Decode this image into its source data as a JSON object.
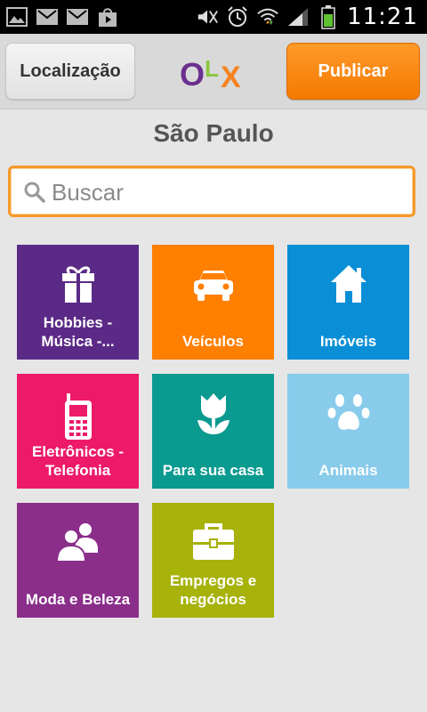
{
  "status_bar": {
    "time": "11:21",
    "left_icons": [
      "image-icon",
      "mail-icon",
      "mail-icon",
      "store-icon"
    ],
    "right_icons": [
      "mute-icon",
      "alarm-icon",
      "wifi-icon",
      "signal-icon",
      "battery-icon"
    ]
  },
  "header": {
    "location_label": "Localização",
    "publish_label": "Publicar",
    "logo_letters": [
      "O",
      "L",
      "X"
    ],
    "logo_colors": [
      "#6a2f8e",
      "#8dc63f",
      "#f58220"
    ]
  },
  "city": "São Paulo",
  "search": {
    "placeholder": "Buscar",
    "value": ""
  },
  "categories": [
    {
      "label": "Hobbies -\nMúsica -...",
      "icon": "gift-icon",
      "color": "#5b2a86"
    },
    {
      "label": "Veículos",
      "icon": "car-icon",
      "color": "#ff7f00"
    },
    {
      "label": "Imóveis",
      "icon": "house-icon",
      "color": "#0a8fd6"
    },
    {
      "label": "Eletrônicos -\nTelefonia",
      "icon": "phone-icon",
      "color": "#ec1a69"
    },
    {
      "label": "Para sua casa",
      "icon": "tulip-icon",
      "color": "#0a9a8f"
    },
    {
      "label": "Animais",
      "icon": "paw-icon",
      "color": "#88cbeb"
    },
    {
      "label": "Moda e Beleza",
      "icon": "people-icon",
      "color": "#8a2e8a"
    },
    {
      "label": "Empregos e\nnegócios",
      "icon": "briefcase-icon",
      "color": "#a7b20a"
    }
  ]
}
